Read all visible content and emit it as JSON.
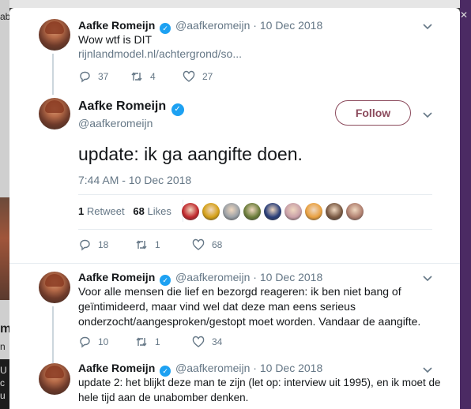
{
  "background": {
    "left_fragments": [
      "ab",
      "m",
      "n",
      "U",
      "c",
      "u"
    ]
  },
  "colors": {
    "verified": "#1da1f2",
    "follow": "#8b4a5c",
    "secondary": "#657786",
    "divider": "#e6ecf0"
  },
  "tweets": [
    {
      "name": "Aafke Romeijn",
      "handle": "@aafkeromeijn",
      "dot": "·",
      "date": "10 Dec 2018",
      "text": "Wow wtf is DIT",
      "link": "rijnlandmodel.nl/achtergrond/so...",
      "replies": "37",
      "retweets": "4",
      "likes": "27"
    },
    {
      "name": "Aafke Romeijn",
      "handle": "@aafkeromeijn",
      "dot": "·",
      "date": "10 Dec 2018",
      "text_lines": [
        "Voor alle mensen die lief en bezorgd reageren: ik ben niet bang of",
        "geïntimideerd, maar vind wel dat deze man eens serieus",
        "onderzocht/aangesproken/gestopt moet worden. Vandaar de aangifte."
      ],
      "replies": "10",
      "retweets": "1",
      "likes": "34"
    },
    {
      "name": "Aafke Romeijn",
      "handle": "@aafkeromeijn",
      "dot": "·",
      "date": "10 Dec 2018",
      "text_lines": [
        "update 2: het blijkt deze man te zijn (let op: interview uit 1995), en ik moet de",
        "hele tijd aan de unabomber denken."
      ]
    }
  ],
  "main": {
    "name": "Aafke Romeijn",
    "handle": "@aafkeromeijn",
    "follow_label": "Follow",
    "text": "update: ik ga aangifte doen.",
    "timestamp": "7:44 AM - 10 Dec 2018",
    "retweet_count": "1",
    "retweet_label": "Retweet",
    "like_count": "68",
    "like_label": "Likes",
    "replies": "18",
    "retweets": "1",
    "likes": "68",
    "liker_colors": [
      "#c0282d",
      "#d4a017",
      "#9aa0a6",
      "#6b7d3a",
      "#2a3f7a",
      "#c9a0a8",
      "#e8a040",
      "#7a5a44",
      "#b08070"
    ]
  }
}
